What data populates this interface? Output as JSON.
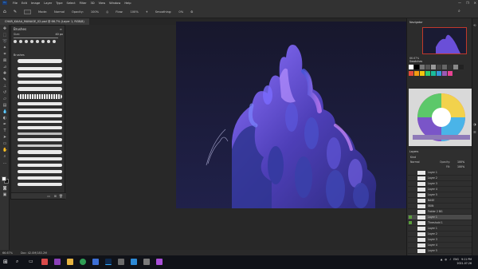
{
  "window": {
    "title": "CHAR_KAlAA_MANAGE_02.psd @ 66.7% (Layer 1, RGB/8)",
    "controls": [
      "—",
      "❐",
      "✕"
    ]
  },
  "menu": [
    "File",
    "Edit",
    "Image",
    "Layer",
    "Type",
    "Select",
    "Filter",
    "3D",
    "View",
    "Window",
    "Help"
  ],
  "options": {
    "mode_label": "Mode:",
    "mode_value": "Normal",
    "opacity_label": "Opacity:",
    "opacity_value": "100%",
    "flow_label": "Flow:",
    "flow_value": "100%",
    "smoothing_label": "Smoothing:",
    "smoothing_value": "0%"
  },
  "brushes_panel": {
    "title": "Brushes",
    "size_label": "Size:",
    "size_value": "40 px",
    "folder_label": "Brushes"
  },
  "statusbar": {
    "zoom": "66.67%",
    "doc": "Doc: 42.0M/183.2M"
  },
  "right_panels": {
    "navigator_title": "Navigator",
    "navigator_zoom": "66.67%",
    "swatches_title": "Swatches",
    "layers_title": "Layers",
    "layers_kind": "Kind",
    "layers_blend": "Normal",
    "layers_opacity_label": "Opacity:",
    "layers_opacity": "100%",
    "layers_fill_label": "Fill:",
    "layers_fill": "100%",
    "layers": [
      {
        "name": "Layer 1",
        "visible": true
      },
      {
        "name": "Layer 2",
        "visible": true
      },
      {
        "name": "Layer 3",
        "visible": true
      },
      {
        "name": "Layer 4",
        "visible": true
      },
      {
        "name": "Layer 5",
        "visible": true
      },
      {
        "name": "BASE",
        "visible": true
      },
      {
        "name": "SKIN",
        "visible": true
      },
      {
        "name": "Folder 2 BG",
        "visible": true
      },
      {
        "name": "Layer 1",
        "visible": true
      },
      {
        "name": "Threshold 1",
        "visible": true
      },
      {
        "name": "Layer 1",
        "visible": true
      },
      {
        "name": "Layer 2",
        "visible": true
      },
      {
        "name": "Layer 3",
        "visible": true
      },
      {
        "name": "Layer 4",
        "visible": true
      },
      {
        "name": "Layer 5",
        "visible": true
      }
    ]
  },
  "taskbar": {
    "clock_time": "9:11 PM",
    "clock_date": "2021-07-26",
    "lang": "ENG"
  },
  "colors": {
    "accent_red": "#c0392b",
    "canvas_bg": "#1b1c3c",
    "shape_purple": "#6a4fd8"
  }
}
